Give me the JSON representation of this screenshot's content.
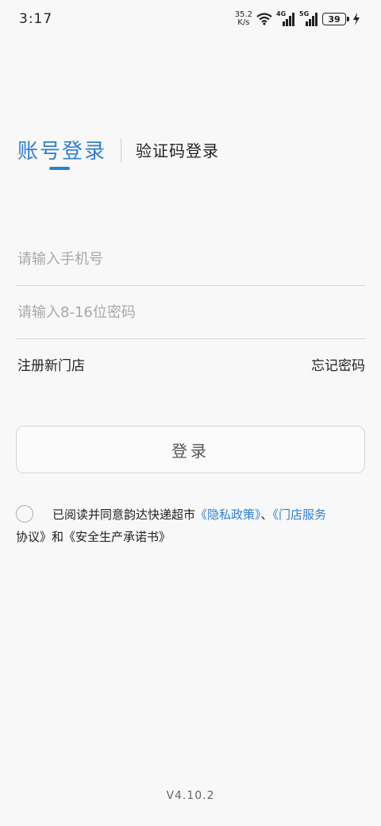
{
  "status_bar": {
    "time": "3:17",
    "net_speed_value": "35.2",
    "net_speed_unit": "K/s",
    "signal_1_label": "4G",
    "signal_2_label": "5G",
    "battery_level": "39",
    "icons": [
      "wifi-icon",
      "signal-icon",
      "signal-icon",
      "battery-icon",
      "charging-icon"
    ]
  },
  "tabs": {
    "account_login": "账号登录",
    "code_login": "验证码登录"
  },
  "form": {
    "phone_placeholder": "请输入手机号",
    "password_placeholder": "请输入8-16位密码"
  },
  "links": {
    "register": "注册新门店",
    "forgot_password": "忘记密码"
  },
  "login_button": "登录",
  "agreement": {
    "prefix": "已阅读并同意韵达快递超市",
    "privacy_policy": "《隐私政策》",
    "separator": "、",
    "store_service_part1": "《门店服务",
    "store_service_part2": "协议》",
    "and": "和",
    "safety_commitment": "《安全生产承诺书》"
  },
  "version": "V4.10.2",
  "colors": {
    "accent": "#2f7fd0",
    "background": "#f8f8f8"
  }
}
